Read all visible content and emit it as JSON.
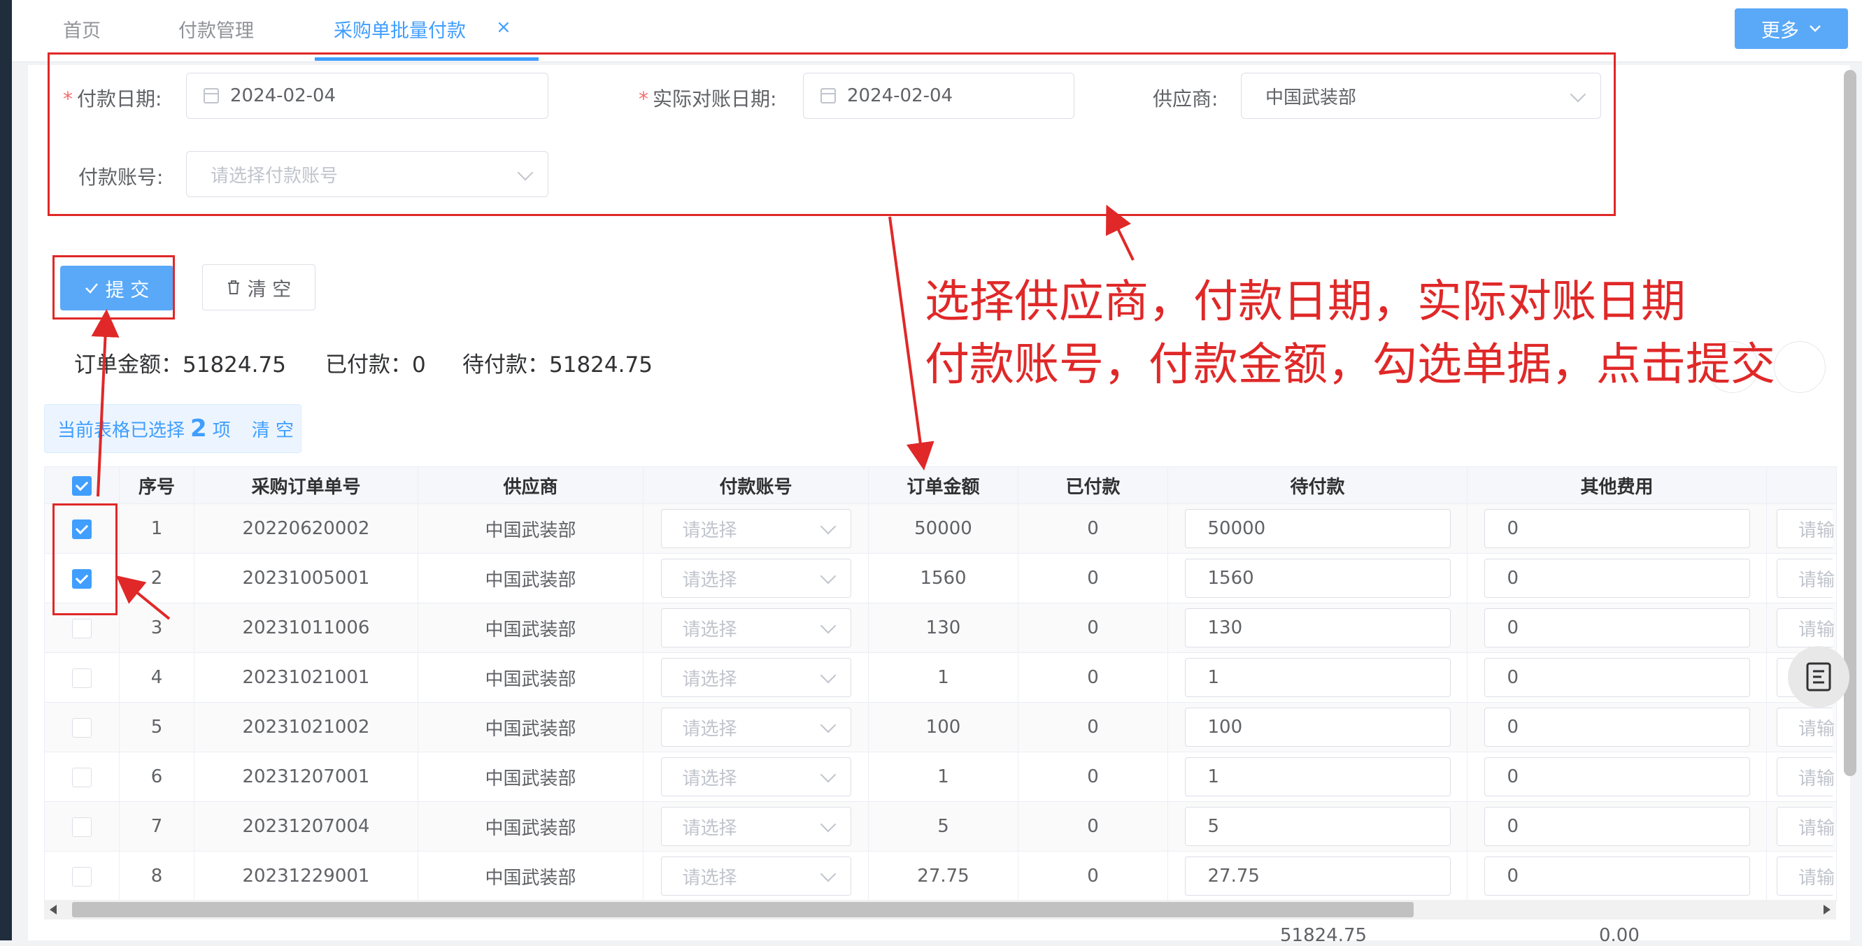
{
  "tabs": [
    {
      "label": "首页"
    },
    {
      "label": "付款管理"
    },
    {
      "label": "采购单批量付款"
    }
  ],
  "tab_close": "×",
  "more_button": "更多",
  "form": {
    "pay_date_label": "付款日期:",
    "pay_date_value": "2024-02-04",
    "recon_date_label": "实际对账日期:",
    "recon_date_value": "2024-02-04",
    "supplier_label": "供应商:",
    "supplier_value": "中国武装部",
    "account_label": "付款账号:",
    "account_placeholder": "请选择付款账号",
    "required_mark": "*"
  },
  "buttons": {
    "submit": "提 交",
    "clear": "清 空"
  },
  "summary": {
    "order_amount": "订单金额：51824.75",
    "paid": "已付款：0",
    "pending": "待付款：51824.75"
  },
  "selection": {
    "prefix": "当前表格已选择",
    "count": "2",
    "suffix": "项",
    "clear": "清 空"
  },
  "annotation": {
    "line1": "选择供应商，付款日期，实际对账日期",
    "line2": "付款账号，付款金额，勾选单据，点击提交"
  },
  "table": {
    "headers": [
      "序号",
      "采购订单单号",
      "供应商",
      "付款账号",
      "订单金额",
      "已付款",
      "待付款",
      "其他费用"
    ],
    "select_placeholder": "请选择",
    "extra_placeholder": "请输",
    "rows": [
      {
        "checked": true,
        "no": "1",
        "order": "20220620002",
        "supplier": "中国武装部",
        "amount": "50000",
        "paid": "0",
        "pending": "50000",
        "other": "0"
      },
      {
        "checked": true,
        "no": "2",
        "order": "20231005001",
        "supplier": "中国武装部",
        "amount": "1560",
        "paid": "0",
        "pending": "1560",
        "other": "0"
      },
      {
        "checked": false,
        "no": "3",
        "order": "20231011006",
        "supplier": "中国武装部",
        "amount": "130",
        "paid": "0",
        "pending": "130",
        "other": "0"
      },
      {
        "checked": false,
        "no": "4",
        "order": "20231021001",
        "supplier": "中国武装部",
        "amount": "1",
        "paid": "0",
        "pending": "1",
        "other": "0"
      },
      {
        "checked": false,
        "no": "5",
        "order": "20231021002",
        "supplier": "中国武装部",
        "amount": "100",
        "paid": "0",
        "pending": "100",
        "other": "0"
      },
      {
        "checked": false,
        "no": "6",
        "order": "20231207001",
        "supplier": "中国武装部",
        "amount": "1",
        "paid": "0",
        "pending": "1",
        "other": "0"
      },
      {
        "checked": false,
        "no": "7",
        "order": "20231207004",
        "supplier": "中国武装部",
        "amount": "5",
        "paid": "0",
        "pending": "5",
        "other": "0"
      },
      {
        "checked": false,
        "no": "8",
        "order": "20231229001",
        "supplier": "中国武装部",
        "amount": "27.75",
        "paid": "0",
        "pending": "27.75",
        "other": "0"
      }
    ],
    "footer_pending": "51824.75",
    "footer_other": "0.00"
  },
  "colors": {
    "primary": "#409eff",
    "annotation_red": "#e02828"
  }
}
